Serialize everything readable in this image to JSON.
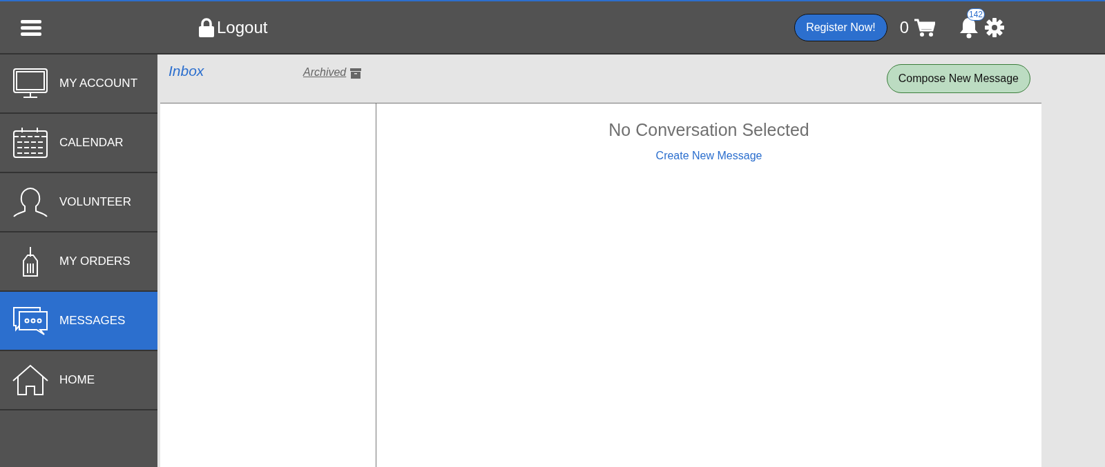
{
  "topbar": {
    "logout": "Logout",
    "register_button": "Register Now!",
    "cart_count": "0",
    "notification_count": "142"
  },
  "sidebar": {
    "items": [
      {
        "label": "MY ACCOUNT",
        "selected": false
      },
      {
        "label": "CALENDAR",
        "selected": false
      },
      {
        "label": "VOLUNTEER",
        "selected": false
      },
      {
        "label": "MY ORDERS",
        "selected": false
      },
      {
        "label": "MESSAGES",
        "selected": true
      },
      {
        "label": "HOME",
        "selected": false
      }
    ]
  },
  "messages": {
    "tabs": [
      {
        "label": "Inbox",
        "selected": true
      },
      {
        "label": "Archived",
        "selected": false
      }
    ],
    "compose_button": "Compose New Message",
    "empty_title": "No Conversation Selected",
    "create_link": "Create New Message"
  }
}
